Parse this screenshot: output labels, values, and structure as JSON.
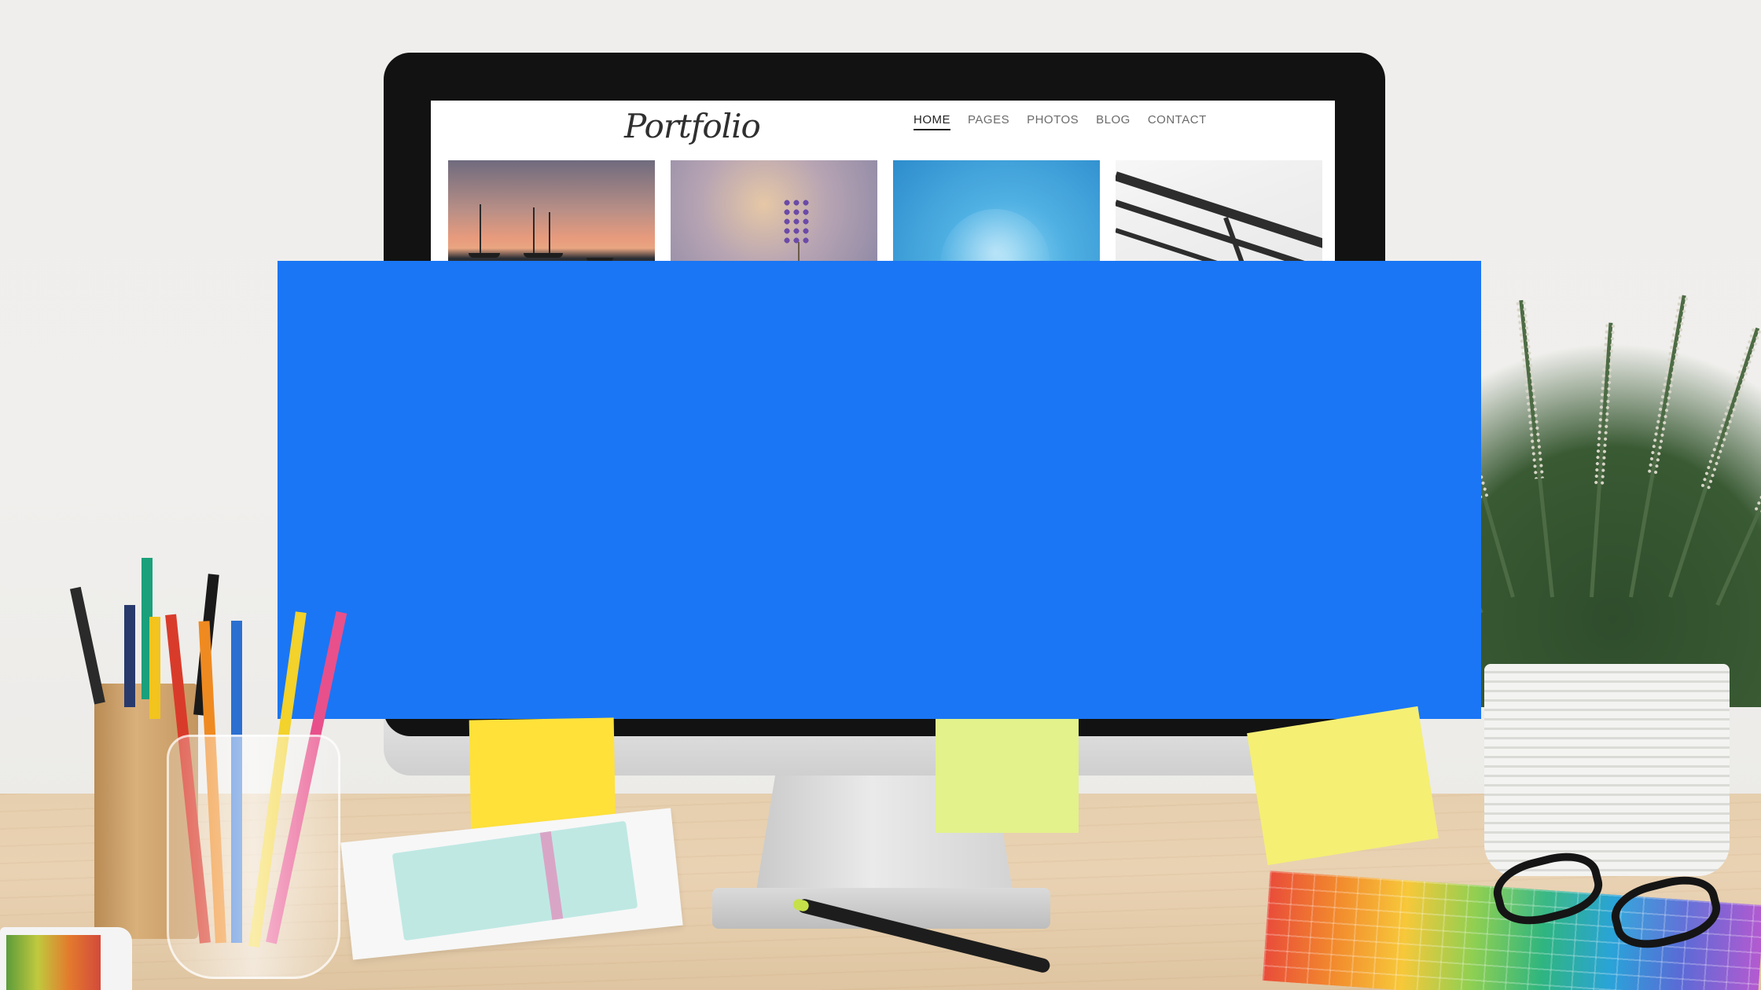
{
  "site": {
    "logo": "Portfolio",
    "nav": [
      {
        "label": "HOME",
        "active": true
      },
      {
        "label": "PAGES",
        "active": false
      },
      {
        "label": "PHOTOS",
        "active": false
      },
      {
        "label": "BLOG",
        "active": false
      },
      {
        "label": "CONTACT",
        "active": false
      }
    ]
  },
  "overlay": {
    "color": "#1a76f5"
  },
  "sticky_notes": [
    {
      "color": "#ffe13a"
    },
    {
      "color": "#e3f28a"
    },
    {
      "color": "#f5ef74"
    }
  ]
}
